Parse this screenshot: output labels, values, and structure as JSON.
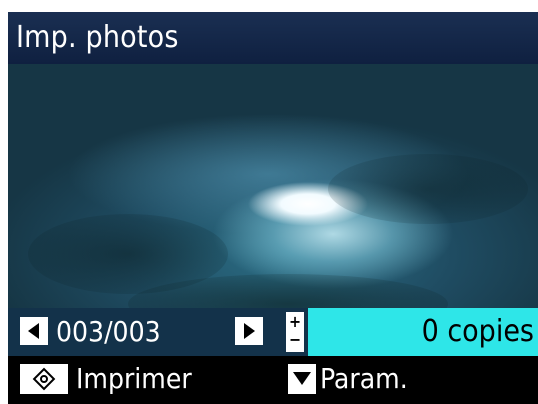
{
  "screen": {
    "title": "Imp. photos"
  },
  "photo": {
    "description_icon": "underwater-seabed-photo"
  },
  "navigation": {
    "prev_icon": "triangle-left-icon",
    "counter": "003/003",
    "next_icon": "triangle-right-icon"
  },
  "copies": {
    "plus_symbol": "+",
    "minus_symbol": "−",
    "text": "0 copies",
    "highlight_color": "#2ee6e8"
  },
  "bottom": {
    "print_icon": "start-diamond-icon",
    "print_label": "Imprimer",
    "settings_icon": "triangle-down-icon",
    "settings_label": "Param."
  }
}
